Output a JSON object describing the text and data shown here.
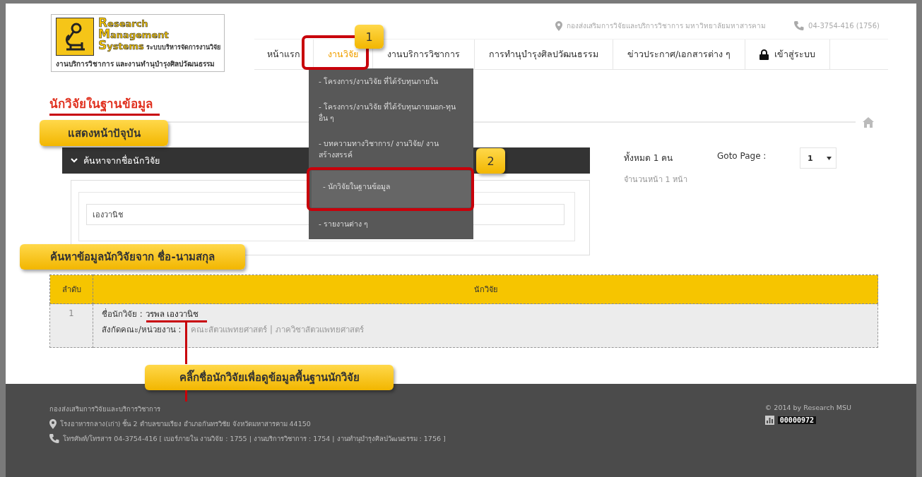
{
  "top_info": {
    "address": "กองส่งเสริมการวิจัยและบริการวิชาการ มหาวิทยาลัยมหาสารคาม",
    "phone": "04-3754-416 (1756)"
  },
  "logo": {
    "lines": [
      "Research",
      "Management",
      "Systems"
    ],
    "subtitle": "ระบบบริหารจัดการงานวิจัย",
    "tagline": "งานบริการวิชาการ และงานทำนุบำรุงศิลปวัฒนธรรม"
  },
  "nav": [
    {
      "label": "หน้าแรก",
      "selected": false,
      "kind": "link"
    },
    {
      "label": "งานวิจัย",
      "selected": true,
      "kind": "link"
    },
    {
      "label": "งานบริการวิชาการ",
      "selected": false,
      "kind": "link"
    },
    {
      "label": "การทำนุบำรุงศิลปวัฒนธรรม",
      "selected": false,
      "kind": "link"
    },
    {
      "label": "ข่าวประกาศ/เอกสารต่าง ๆ",
      "selected": false,
      "kind": "link"
    },
    {
      "label": "เข้าสู่ระบบ",
      "selected": false,
      "kind": "login"
    }
  ],
  "dropdown": [
    {
      "label": "- โครงการ/งานวิจัย ที่ได้รับทุนภายใน",
      "selected": false
    },
    {
      "label": "- โครงการ/งานวิจัย ที่ได้รับทุนภายนอก-ทุนอื่น ๆ",
      "selected": false
    },
    {
      "label": "- บทความทางวิชาการ/ งานวิจัย/ งานสร้างสรรค์",
      "selected": false
    },
    {
      "label": "- นักวิจัยในฐานข้อมูล",
      "selected": true
    },
    {
      "label": "- รายงานต่าง ๆ",
      "selected": false
    }
  ],
  "page_title": "นักวิจัยในฐานข้อมูล",
  "search": {
    "title": "ค้นหาจากชื่อนักวิจัย",
    "value": "เองวานิช"
  },
  "summary": {
    "total": "ทั้งหมด 1 คน",
    "pages": "จำนวนหน้า 1 หน้า",
    "goto_label": "Goto Page :",
    "page_select": "1"
  },
  "table": {
    "columns": [
      "ลำดับ",
      "นักวิจัย"
    ],
    "rows": [
      {
        "index": "1",
        "name_label": "ชื่อนักวิจัย :",
        "name": "วรพล เองวานิช",
        "unit_label": "สังกัดคณะ/หน่วยงาน :",
        "unit": "คณะสัตวแพทยศาสตร์ | ภาควิชาสัตวแพทยศาสตร์"
      }
    ]
  },
  "footer": {
    "org": "กองส่งเสริมการวิจัยและบริการวิชาการ",
    "address": "โรงอาหารกลาง(เก่า) ชั้น 2 ตำบลขามเรียง อำเภอกันทรวิชัย จังหวัดมหาสารคาม 44150",
    "phone": "โทรศัพท์/โทรสาร 04-3754-416 [ เบอร์ภายใน งานวิจัย : 1755 | งานบริการวิชาการ : 1754 | งานทำนุบำรุงศิลปวัฒนธรรม : 1756 ]",
    "copyright": "© 2014 by Research MSU",
    "counter": "00000972"
  },
  "annotations": [
    {
      "kind": "number",
      "text": "1"
    },
    {
      "kind": "number",
      "text": "2"
    },
    {
      "kind": "label",
      "text": "แสดงหน้าปัจุบัน"
    },
    {
      "kind": "label",
      "text": "ค้นหาข้อมูลนักวิจัยจาก ชื่อ-นามสกุล"
    },
    {
      "kind": "label",
      "text": "คลิ๊กชื่อนักวิจัยเพื่อดูข้อมูลพื้นฐานนักวิจัย"
    }
  ]
}
